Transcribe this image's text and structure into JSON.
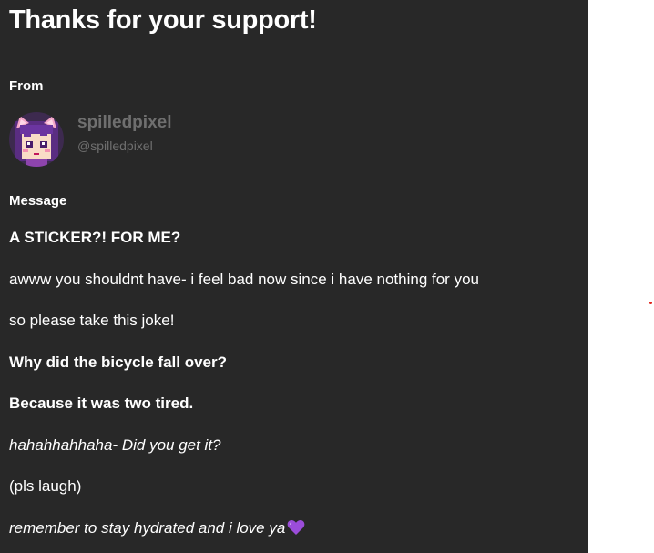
{
  "title": "Thanks for your support!",
  "from_label": "From",
  "user": {
    "name": "spilledpixel",
    "handle": "@spilledpixel",
    "avatar_icon": "pixel-art-avatar"
  },
  "message_label": "Message",
  "message": {
    "line1": "A STICKER?! FOR ME?",
    "line2": "awww you shouldnt have- i feel bad now since i have nothing for you",
    "line3": "so please take this joke!",
    "line4": "Why did the bicycle fall over?",
    "line5": "Because it was two tired.",
    "line6": "hahahhahhaha- Did you get it?",
    "line7": "(pls laugh)",
    "line8": "remember to stay hydrated and i love ya",
    "heart_icon": "purple-heart-icon"
  },
  "colors": {
    "panel_bg": "#282828",
    "text": "#ffffff",
    "muted_text": "#6f6f6f",
    "heart": "#9b4dd9"
  }
}
